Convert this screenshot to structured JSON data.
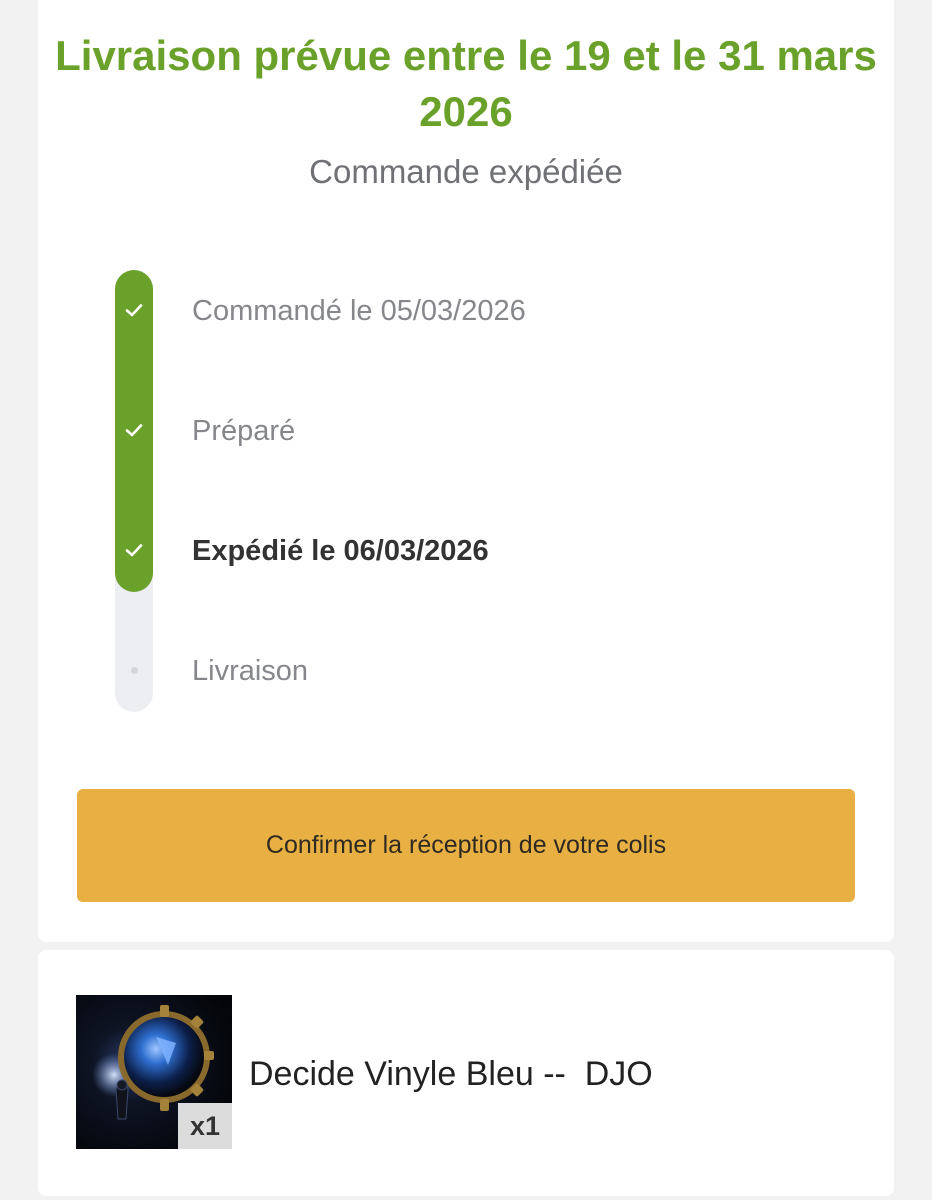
{
  "header": {
    "delivery_estimate": "Livraison prévue entre le 19 et le 31 mars 2026",
    "order_status": "Commande expédiée"
  },
  "tracking": {
    "accent_color": "#6aa12a",
    "steps": [
      {
        "label": "Commandé le 05/03/2026",
        "state": "done",
        "icon": "check-icon"
      },
      {
        "label": "Préparé",
        "state": "done",
        "icon": "check-icon"
      },
      {
        "label": "Expédié le 06/03/2026",
        "state": "current",
        "icon": "check-icon"
      },
      {
        "label": "Livraison",
        "state": "pending",
        "icon": "dot-icon"
      }
    ]
  },
  "actions": {
    "confirm_label": "Confirmer la réception de votre colis",
    "confirm_color": "#e8b043"
  },
  "product": {
    "name": "Decide Vinyle Bleu --  DJO",
    "quantity": "x1",
    "image": "album-cover-image"
  }
}
